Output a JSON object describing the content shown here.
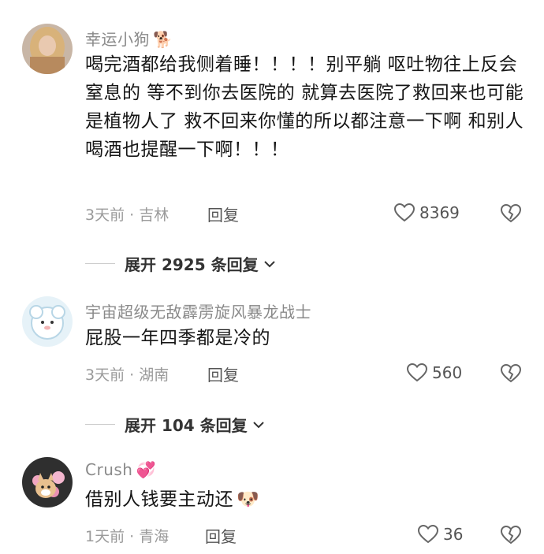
{
  "comments": [
    {
      "username": "幸运小狗",
      "username_emoji": "🐕",
      "text": "喝完酒都给我侧着睡！！！！别平躺  呕吐物往上反会窒息的  等不到你去医院的  就算去医院了救回来也可能是植物人了  救不回来你懂的所以都注意一下啊  和别人喝酒也提醒一下啊！！！",
      "time_location": "3天前 · 吉林",
      "reply_label": "回复",
      "likes": "8369",
      "expand_label": "展开 2925 条回复"
    },
    {
      "username": "宇宙超级无敌霹雳旋风暴龙战士",
      "text": "屁股一年四季都是冷的",
      "time_location": "3天前 · 湖南",
      "reply_label": "回复",
      "likes": "560",
      "expand_label": "展开 104 条回复"
    },
    {
      "username": "Crush",
      "username_emoji": "💞",
      "text": "借别人钱要主动还",
      "text_emoji": "🐶",
      "time_location": "1天前 · 青海",
      "reply_label": "回复",
      "likes": "36"
    }
  ],
  "icons": {
    "like": "heart-outline-icon",
    "dislike": "broken-heart-icon",
    "expand": "chevron-down-icon"
  }
}
